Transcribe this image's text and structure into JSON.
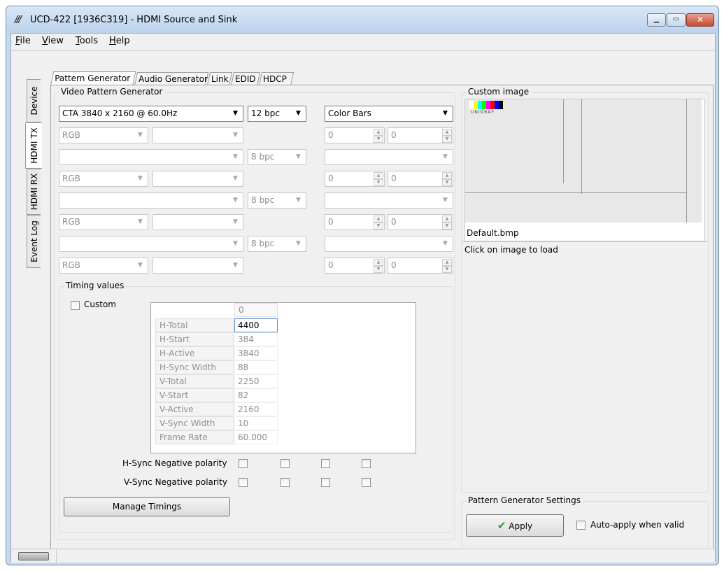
{
  "window": {
    "title": "UCD-422 [1936C319] - HDMI Source and Sink",
    "icon": "unigraf-logo-icon"
  },
  "menu": [
    {
      "label": "File",
      "accel": "F"
    },
    {
      "label": "View",
      "accel": "V"
    },
    {
      "label": "Tools",
      "accel": "T"
    },
    {
      "label": "Help",
      "accel": "H"
    }
  ],
  "side_tabs": [
    "Device",
    "HDMI TX",
    "HDMI RX",
    "Event Log"
  ],
  "top_tabs": [
    "Pattern Generator",
    "Audio Generator",
    "Link",
    "EDID",
    "HDCP"
  ],
  "vpg": {
    "title": "Video Pattern Generator",
    "resolution": "CTA 3840 x 2160 @ 60.0Hz",
    "bpc": "12 bpc",
    "pattern": "Color Bars",
    "rows": [
      {
        "cs": "RGB",
        "sub": "",
        "p1": "0",
        "p2": "0"
      },
      {
        "bpc": "8 bpc"
      },
      {
        "cs": "RGB",
        "sub": "",
        "p1": "0",
        "p2": "0"
      },
      {
        "bpc": "8 bpc"
      },
      {
        "cs": "RGB",
        "sub": "",
        "p1": "0",
        "p2": "0"
      },
      {
        "bpc": "8 bpc"
      },
      {
        "cs": "RGB",
        "sub": "",
        "p1": "0",
        "p2": "0"
      }
    ]
  },
  "timing": {
    "title": "Timing values",
    "custom_label": "Custom",
    "column": "0",
    "rows": [
      {
        "name": "H-Total",
        "value": "4400"
      },
      {
        "name": "H-Start",
        "value": "384"
      },
      {
        "name": "H-Active",
        "value": "3840"
      },
      {
        "name": "H-Sync Width",
        "value": "88"
      },
      {
        "name": "V-Total",
        "value": "2250"
      },
      {
        "name": "V-Start",
        "value": "82"
      },
      {
        "name": "V-Active",
        "value": "2160"
      },
      {
        "name": "V-Sync Width",
        "value": "10"
      },
      {
        "name": "Frame Rate",
        "value": "60.000"
      }
    ],
    "hsync_label": "H-Sync Negative polarity",
    "vsync_label": "V-Sync Negative polarity",
    "manage_label": "Manage Timings"
  },
  "custom_image": {
    "title": "Custom image",
    "filename": "Default.bmp",
    "hint": "Click on image to load",
    "thumb_brand": "UNIGRAF"
  },
  "settings": {
    "title": "Pattern Generator Settings",
    "apply_label": "Apply",
    "auto_apply_label": "Auto-apply when valid"
  }
}
